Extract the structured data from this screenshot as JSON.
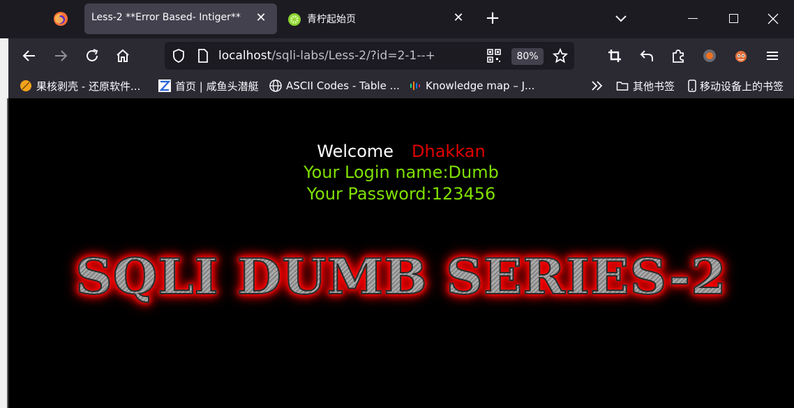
{
  "browser": {
    "tabs": [
      {
        "title": "Less-2 **Error Based- Intiger**",
        "active": true
      },
      {
        "title": "青柠起始页",
        "active": false
      }
    ],
    "url_host": "localhost",
    "url_path": "/sqli-labs/Less-2/?id=2-1--+",
    "zoom": "80%",
    "bookmarks": [
      {
        "label": "果核剥壳 - 还原软件...",
        "icon": "orange-slice-icon"
      },
      {
        "label": "首页 | 咸鱼头潜艇",
        "icon": "z-logo-icon"
      },
      {
        "label": "ASCII Codes - Table ...",
        "icon": "globe-icon"
      },
      {
        "label": "Knowledge map – J...",
        "icon": "bars-icon"
      }
    ],
    "other_bookmarks": "其他书签",
    "mobile_bookmarks": "移动设备上的书签"
  },
  "page": {
    "welcome": "Welcome",
    "user_name_highlight": "Dhakkan",
    "login_name": "Your Login name:Dumb",
    "password": "Your Password:123456",
    "banner": "SQLI DUMB SERIES-2"
  },
  "colors": {
    "tab_bg": "#1c1b22",
    "toolbar_bg": "#2b2a33",
    "welcome_white": "#ffffff",
    "dhakkan_red": "#e00000",
    "login_green": "#7fe000",
    "banner_glow": "#ff0000"
  }
}
